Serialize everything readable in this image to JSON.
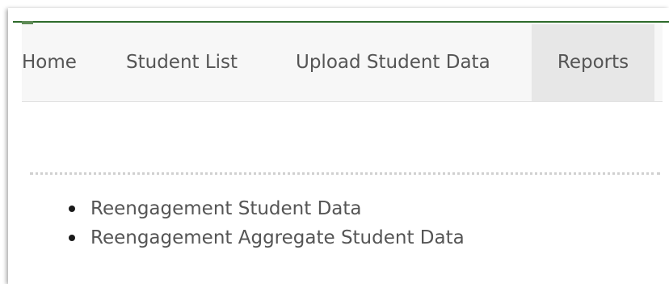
{
  "nav": {
    "home": "Home",
    "student_list": "Student List",
    "upload": "Upload Student Data",
    "reports": "Reports",
    "active": "Reports"
  },
  "reports": {
    "links": [
      "Reengagement Student Data",
      "Reengagement Aggregate Student Data"
    ]
  },
  "colors": {
    "accent_line": "#2e6b2b",
    "text": "#555555",
    "nav_bg": "#f7f7f7",
    "nav_active_bg": "#e7e7e7"
  }
}
